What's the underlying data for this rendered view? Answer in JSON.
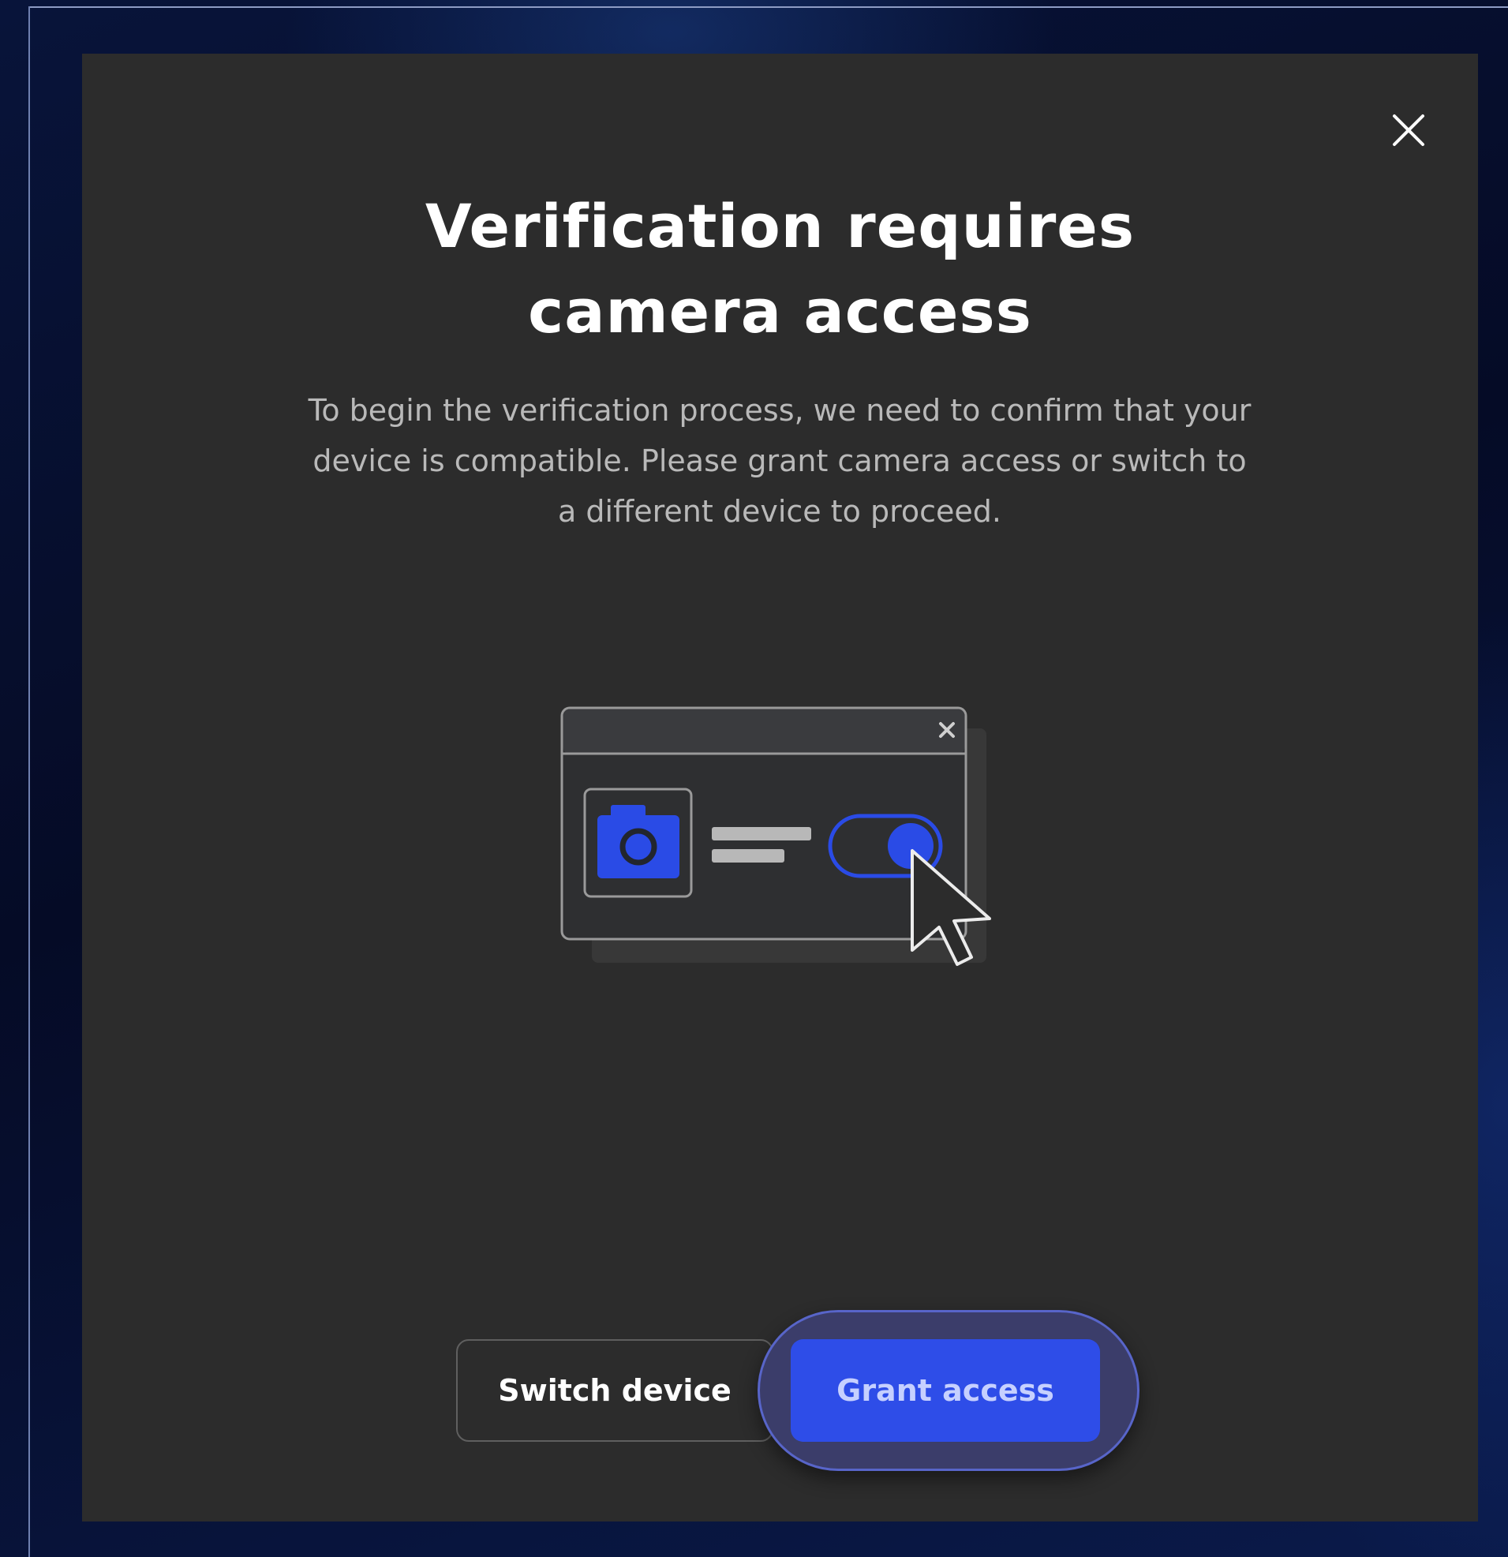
{
  "dialog": {
    "title_line1": "Verification requires",
    "title_line2": "camera access",
    "description": "To begin the verification process, we need to confirm that your device is compatible. Please grant camera access or switch to a different device to proceed.",
    "close_icon": "close-icon"
  },
  "illustration": {
    "icons": [
      "browser-window-icon",
      "close-icon",
      "camera-icon",
      "toggle-switch-icon",
      "mouse-pointer-icon"
    ],
    "toggle_on": true
  },
  "actions": {
    "switch_device_label": "Switch device",
    "grant_access_label": "Grant access"
  },
  "colors": {
    "accent": "#2e4de8",
    "modal_bg": "#2c2c2c",
    "page_bg": "#050b26"
  }
}
